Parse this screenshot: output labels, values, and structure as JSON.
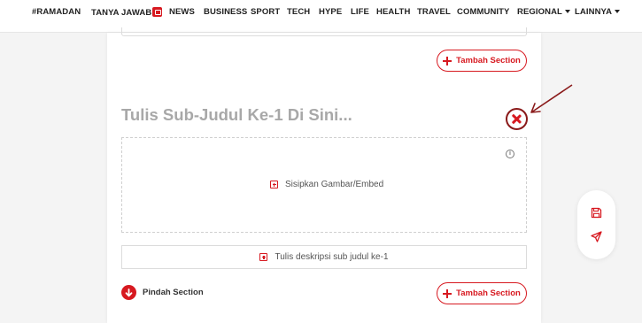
{
  "nav": {
    "items": [
      "#RAMADAN",
      "TANYA JAWAB",
      "NEWS",
      "BUSINESS",
      "SPORT",
      "TECH",
      "HYPE",
      "LIFE",
      "HEALTH",
      "TRAVEL",
      "COMMUNITY",
      "REGIONAL",
      "LAINNYA"
    ]
  },
  "editor": {
    "add_section_label": "Tambah Section",
    "subtitle_placeholder": "Tulis Sub-Judul Ke-1 Di Sini...",
    "media_label": "Sisipkan Gambar/Embed",
    "description_label": "Tulis deskripsi sub judul ke-1",
    "move_section_label": "Pindah Section"
  },
  "icons": {
    "close": "close-icon",
    "info": "info-icon",
    "save": "save-icon",
    "send": "send-icon",
    "arrow_down": "arrow-down-icon",
    "plus": "plus-icon"
  },
  "colors": {
    "accent": "#d71920",
    "annotation": "#8a1a1a",
    "placeholder": "#a8a8a8"
  }
}
